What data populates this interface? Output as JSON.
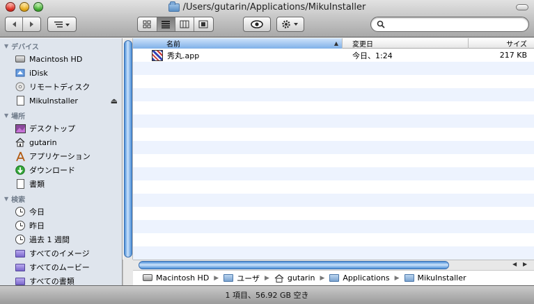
{
  "window": {
    "title": "/Users/gutarin/Applications/MikuInstaller"
  },
  "toolbar": {
    "back_icon": "chevron-left-icon",
    "forward_icon": "chevron-right-icon",
    "search_placeholder": "",
    "search_value": ""
  },
  "sidebar": {
    "sections": [
      {
        "title": "デバイス",
        "items": [
          {
            "label": "Macintosh HD",
            "icon": "hard-drive-icon"
          },
          {
            "label": "iDisk",
            "icon": "idisk-icon"
          },
          {
            "label": "リモートディスク",
            "icon": "remote-disc-icon"
          },
          {
            "label": "MikuInstaller",
            "icon": "disk-image-icon",
            "eject": "⏏"
          }
        ]
      },
      {
        "title": "場所",
        "items": [
          {
            "label": "デスクトップ",
            "icon": "desktop-icon"
          },
          {
            "label": "gutarin",
            "icon": "home-icon"
          },
          {
            "label": "アプリケーション",
            "icon": "applications-icon"
          },
          {
            "label": "ダウンロード",
            "icon": "downloads-icon"
          },
          {
            "label": "書類",
            "icon": "documents-icon"
          }
        ]
      },
      {
        "title": "検索",
        "items": [
          {
            "label": "今日",
            "icon": "clock-icon"
          },
          {
            "label": "昨日",
            "icon": "clock-icon"
          },
          {
            "label": "過去 1 週間",
            "icon": "clock-icon"
          },
          {
            "label": "すべてのイメージ",
            "icon": "smart-folder-icon"
          },
          {
            "label": "すべてのムービー",
            "icon": "smart-folder-icon"
          },
          {
            "label": "すべての書類",
            "icon": "smart-folder-icon"
          }
        ]
      }
    ]
  },
  "filelist": {
    "columns": [
      {
        "label": "名前"
      },
      {
        "label": "変更日"
      },
      {
        "label": "サイズ"
      }
    ],
    "rows": [
      {
        "name": "秀丸.app",
        "modified": "今日、1:24",
        "size": "217 KB"
      }
    ]
  },
  "pathbar": {
    "crumbs": [
      {
        "label": "Macintosh HD",
        "icon": "hard-drive-icon"
      },
      {
        "label": "ユーザ",
        "icon": "folder-icon"
      },
      {
        "label": "gutarin",
        "icon": "home-icon"
      },
      {
        "label": "Applications",
        "icon": "folder-icon"
      },
      {
        "label": "MikuInstaller",
        "icon": "folder-icon"
      }
    ]
  },
  "status": {
    "text": "1 項目、56.92 GB 空き"
  },
  "colors": {
    "sidebar_bg": "#dfe5ed",
    "stripe": "#edf3fe",
    "scroll_thumb": "#4b8fd8"
  }
}
